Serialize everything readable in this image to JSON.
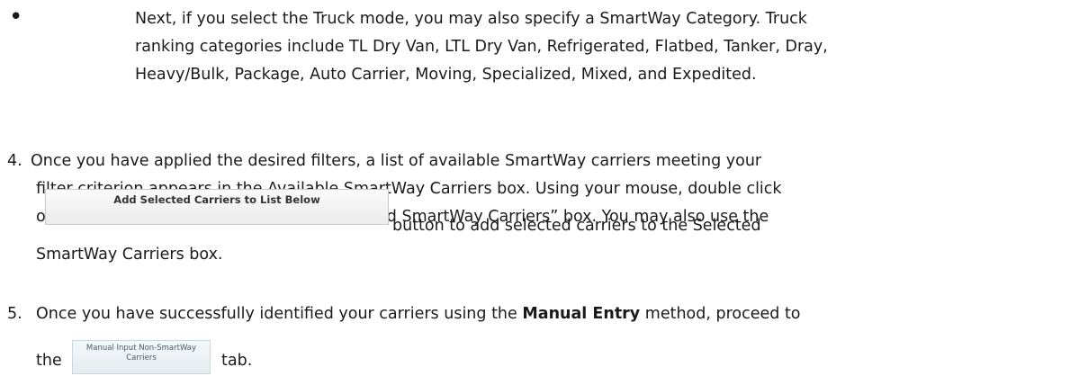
{
  "bullet": {
    "symbol": "•",
    "lines": [
      "Next, if you select the Truck mode, you may also specify a SmartWay Category.  Truck",
      "ranking categories include TL Dry Van, LTL Dry Van, Refrigerated, Flatbed, Tanker, Dray,",
      "Heavy/Bulk, Package, Auto Carrier, Moving, Specialized, Mixed, and Expedited."
    ]
  },
  "item4": {
    "number": "4.",
    "lines": [
      " Once you have applied the desired filters, a list of available SmartWay carriers meeting your",
      "filter criterion appears in the Available SmartWay Carriers box.  Using your mouse, double click",
      "on the carrier name to add it to the “Selected SmartWay Carriers” box.  You may also use the"
    ],
    "button_label": "Add Selected Carriers to List Below",
    "after_button": "button to add selected carriers to the Selected",
    "last_line": "SmartWay Carriers box."
  },
  "item5": {
    "number": "5.",
    "line1_pre": "Once you have successfully identified your carriers using the ",
    "line1_bold": "Manual Entry",
    "line1_post": " method, proceed to",
    "line2_pre": "the",
    "tab_label_line1": "Manual Input Non-SmartWay",
    "tab_label_line2": "Carriers",
    "line2_post": "tab."
  }
}
